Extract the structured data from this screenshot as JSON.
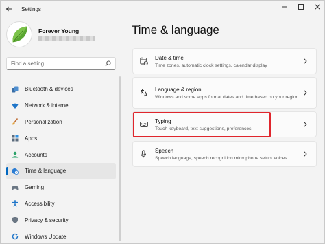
{
  "window": {
    "title": "Settings"
  },
  "profile": {
    "name": "Forever Young"
  },
  "search": {
    "placeholder": "Find a setting"
  },
  "sidebar": {
    "items": [
      {
        "label": "Bluetooth & devices",
        "icon": "bluetooth-icon"
      },
      {
        "label": "Network & internet",
        "icon": "wifi-icon"
      },
      {
        "label": "Personalization",
        "icon": "brush-icon"
      },
      {
        "label": "Apps",
        "icon": "apps-icon"
      },
      {
        "label": "Accounts",
        "icon": "person-icon"
      },
      {
        "label": "Time & language",
        "icon": "globe-clock-icon",
        "active": true
      },
      {
        "label": "Gaming",
        "icon": "gamepad-icon"
      },
      {
        "label": "Accessibility",
        "icon": "accessibility-icon"
      },
      {
        "label": "Privacy & security",
        "icon": "shield-icon"
      },
      {
        "label": "Windows Update",
        "icon": "update-icon"
      }
    ]
  },
  "main": {
    "title": "Time & language",
    "cards": [
      {
        "title": "Date & time",
        "description": "Time zones, automatic clock settings, calendar display",
        "icon": "date-time-icon"
      },
      {
        "title": "Language & region",
        "description": "Windows and some apps format dates and time based on your region",
        "icon": "language-icon"
      },
      {
        "title": "Typing",
        "description": "Touch keyboard, text suggestions, preferences",
        "icon": "keyboard-icon",
        "highlighted": true
      },
      {
        "title": "Speech",
        "description": "Speech language, speech recognition microphone setup, voices",
        "icon": "microphone-icon"
      }
    ]
  },
  "colors": {
    "accent": "#0067c0",
    "highlight": "#e0262d",
    "background": "#f3f3f3",
    "card": "#fbfbfb"
  }
}
